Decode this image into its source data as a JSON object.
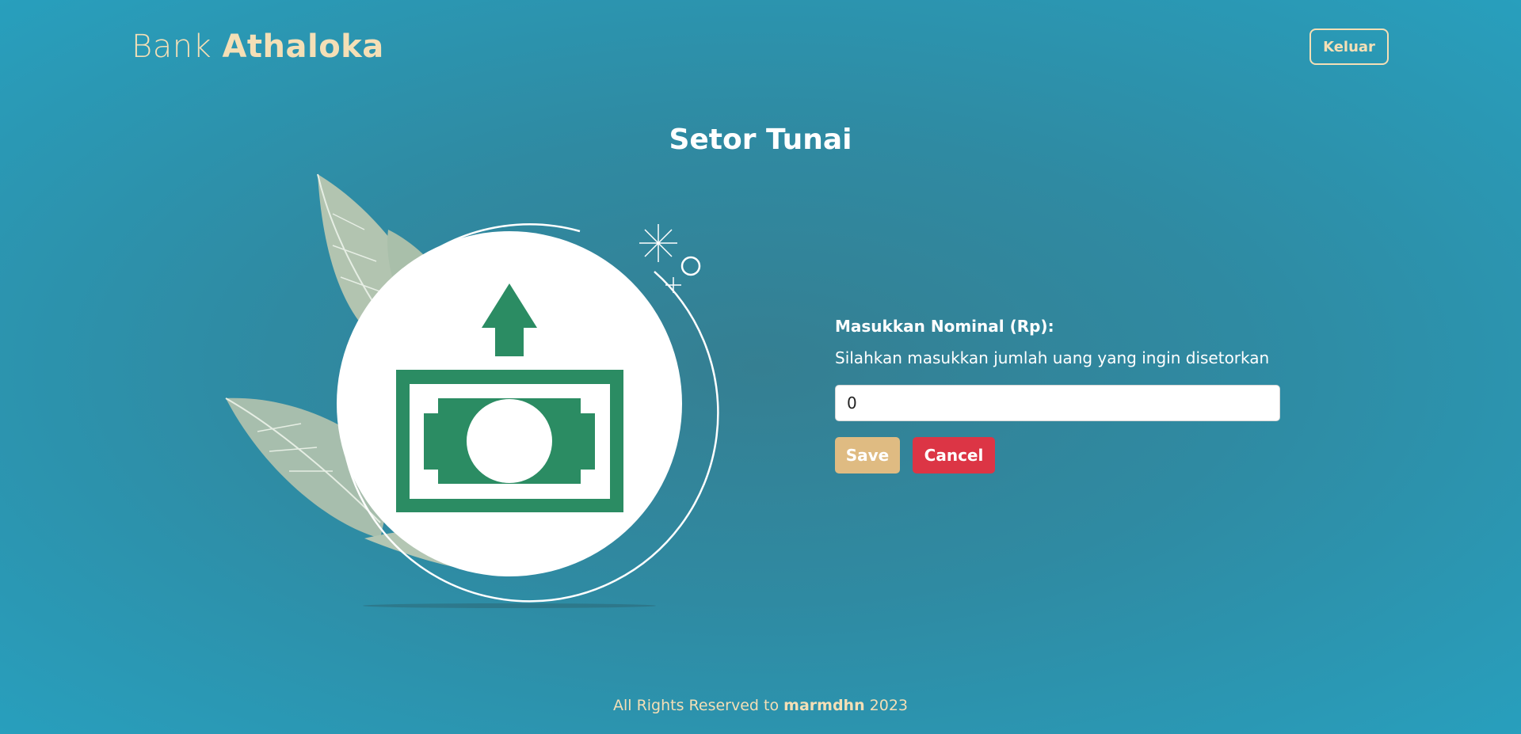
{
  "header": {
    "brand_prefix": "Bank",
    "brand_name": "Athaloka",
    "logout_label": "Keluar"
  },
  "main": {
    "title": "Setor Tunai",
    "form": {
      "label": "Masukkan Nominal (Rp):",
      "help_text": "Silahkan masukkan jumlah uang yang ingin disetorkan",
      "amount_value": "0",
      "save_label": "Save",
      "cancel_label": "Cancel"
    },
    "illustration": {
      "icon": "cash-deposit-icon",
      "colors": {
        "money_green": "#2b8c63",
        "leaf": "#b8c8b2",
        "circle": "#ffffff"
      }
    }
  },
  "footer": {
    "prefix": "All Rights Reserved to",
    "author": "marmdhn",
    "year": "2023"
  },
  "colors": {
    "background": "#2f8aa2",
    "accent_cream": "#f4dfb6",
    "save": "#dfbb82",
    "cancel": "#dc3545"
  }
}
